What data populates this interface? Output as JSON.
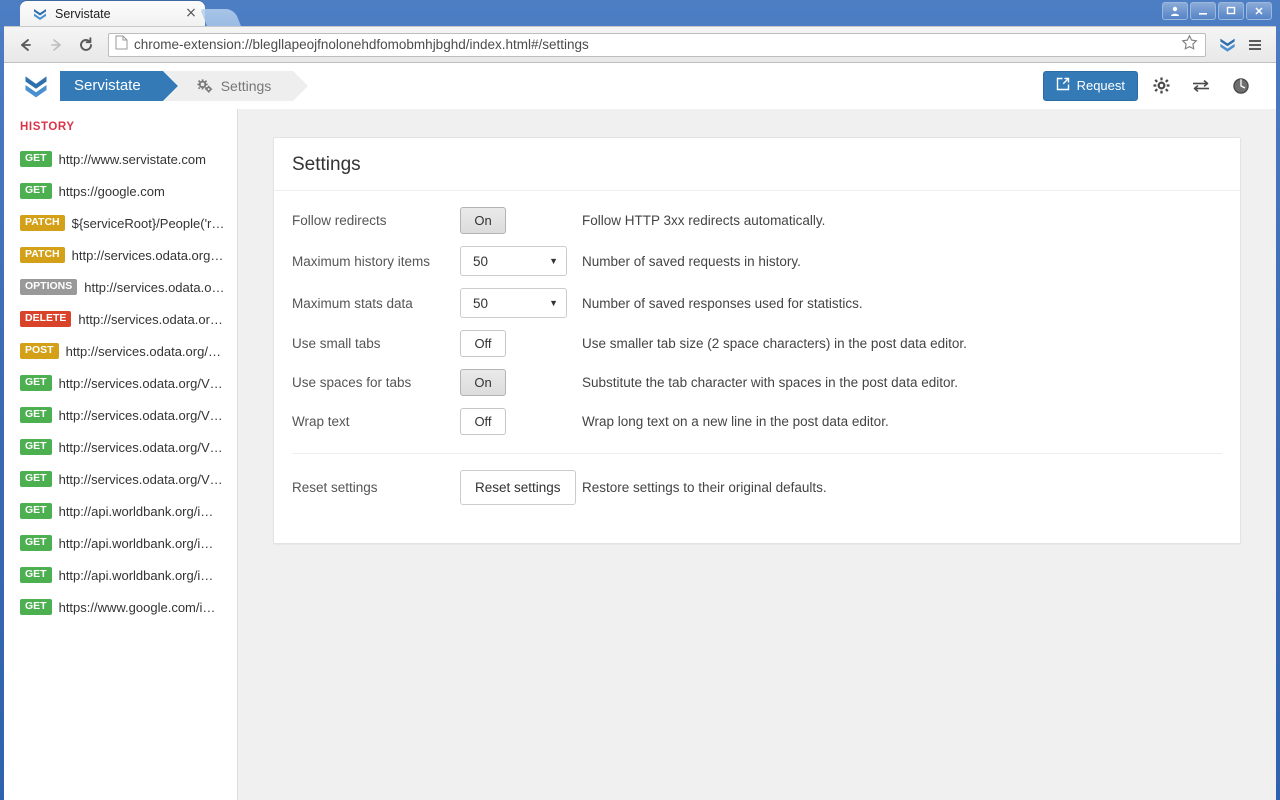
{
  "window": {
    "controls": [
      "user-icon",
      "minimize",
      "maximize",
      "close"
    ]
  },
  "browser": {
    "tab": {
      "title": "Servistate",
      "favicon": "servistate-chevrons-icon",
      "close_label": "×"
    },
    "new_tab_label": "",
    "nav": {
      "back": "←",
      "forward": "→",
      "reload": "⟳"
    },
    "omnibox": {
      "url": "chrome-extension://blegllapeojfnolonehdfomobmhjbghd/index.html#/settings",
      "page_icon": "document-icon",
      "star_icon": "star-icon"
    },
    "extension_icon": "servistate-extension-icon",
    "menu_icon": "hamburger-menu-icon"
  },
  "app": {
    "brand_icon": "servistate-chevrons-icon",
    "breadcrumb": [
      {
        "label": "Servistate",
        "active": true,
        "icon": ""
      },
      {
        "label": "Settings",
        "active": false,
        "icon": "gears-icon"
      }
    ],
    "actions": {
      "request_label": "Request",
      "request_icon": "external-link-icon",
      "gear_icon": "gear-icon",
      "exchange_icon": "exchange-arrows-icon",
      "globe_icon": "globe-icon"
    },
    "colors": {
      "brand_blue": "#337ab7",
      "history_heading": "#d9344a",
      "verb_get": "#4caf50",
      "verb_post": "#d4a017",
      "verb_patch": "#d4a017",
      "verb_delete": "#d9432a",
      "verb_options": "#999999",
      "content_bg": "#f0f0f0"
    }
  },
  "sidebar": {
    "heading": "HISTORY",
    "items": [
      {
        "verb": "GET",
        "url": "http://www.servistate.com"
      },
      {
        "verb": "GET",
        "url": "https://google.com"
      },
      {
        "verb": "PATCH",
        "url": "${serviceRoot}/People('r…"
      },
      {
        "verb": "PATCH",
        "url": "http://services.odata.org…"
      },
      {
        "verb": "OPTIONS",
        "url": "http://services.odata.o…"
      },
      {
        "verb": "DELETE",
        "url": "http://services.odata.or…"
      },
      {
        "verb": "POST",
        "url": "http://services.odata.org/…"
      },
      {
        "verb": "GET",
        "url": "http://services.odata.org/V…"
      },
      {
        "verb": "GET",
        "url": "http://services.odata.org/V…"
      },
      {
        "verb": "GET",
        "url": "http://services.odata.org/V…"
      },
      {
        "verb": "GET",
        "url": "http://services.odata.org/V…"
      },
      {
        "verb": "GET",
        "url": "http://api.worldbank.org/i…"
      },
      {
        "verb": "GET",
        "url": "http://api.worldbank.org/i…"
      },
      {
        "verb": "GET",
        "url": "http://api.worldbank.org/i…"
      },
      {
        "verb": "GET",
        "url": "https://www.google.com/i…"
      }
    ]
  },
  "settings": {
    "title": "Settings",
    "rows": [
      {
        "label": "Follow redirects",
        "control": "toggle",
        "value": "On",
        "description": "Follow HTTP 3xx redirects automatically."
      },
      {
        "label": "Maximum history items",
        "control": "select",
        "value": "50",
        "description": "Number of saved requests in history."
      },
      {
        "label": "Maximum stats data",
        "control": "select",
        "value": "50",
        "description": "Number of saved responses used for statistics."
      },
      {
        "label": "Use small tabs",
        "control": "toggle",
        "value": "Off",
        "description": "Use smaller tab size (2 space characters) in the post data editor."
      },
      {
        "label": "Use spaces for tabs",
        "control": "toggle",
        "value": "On",
        "description": "Substitute the tab character with spaces in the post data editor."
      },
      {
        "label": "Wrap text",
        "control": "toggle",
        "value": "Off",
        "description": "Wrap long text on a new line in the post data editor."
      }
    ],
    "reset": {
      "label": "Reset settings",
      "button_label": "Reset settings",
      "description": "Restore settings to their original defaults."
    }
  }
}
